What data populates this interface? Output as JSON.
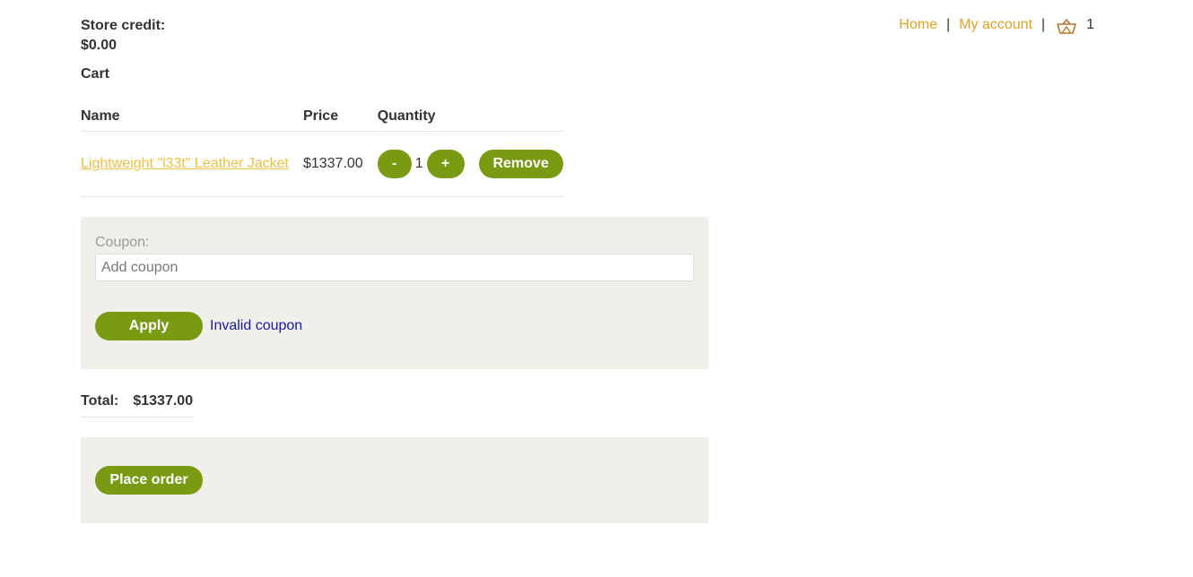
{
  "store_credit": {
    "label": "Store credit:",
    "value": "$0.00"
  },
  "nav": {
    "home": "Home",
    "separator": "|",
    "account": "My account",
    "cart_icon": "basket-icon",
    "cart_count": "1"
  },
  "cart": {
    "heading": "Cart",
    "columns": [
      "Name",
      "Price",
      "Quantity"
    ],
    "items": [
      {
        "name": "Lightweight \"l33t\" Leather Jacket",
        "price": "$1337.00",
        "minus_label": "-",
        "quantity": "1",
        "plus_label": "+",
        "remove_label": "Remove"
      }
    ]
  },
  "coupon": {
    "label": "Coupon:",
    "placeholder": "Add coupon",
    "apply_label": "Apply",
    "status": "Invalid coupon"
  },
  "total": {
    "label": "Total:",
    "value": "$1337.00"
  },
  "order": {
    "place_label": "Place order"
  },
  "colors": {
    "accent": "#7a9a13",
    "link": "#e0a224",
    "product_link": "#f0c040",
    "panel_bg": "#f0efea",
    "status_text": "#1a1aa6"
  }
}
